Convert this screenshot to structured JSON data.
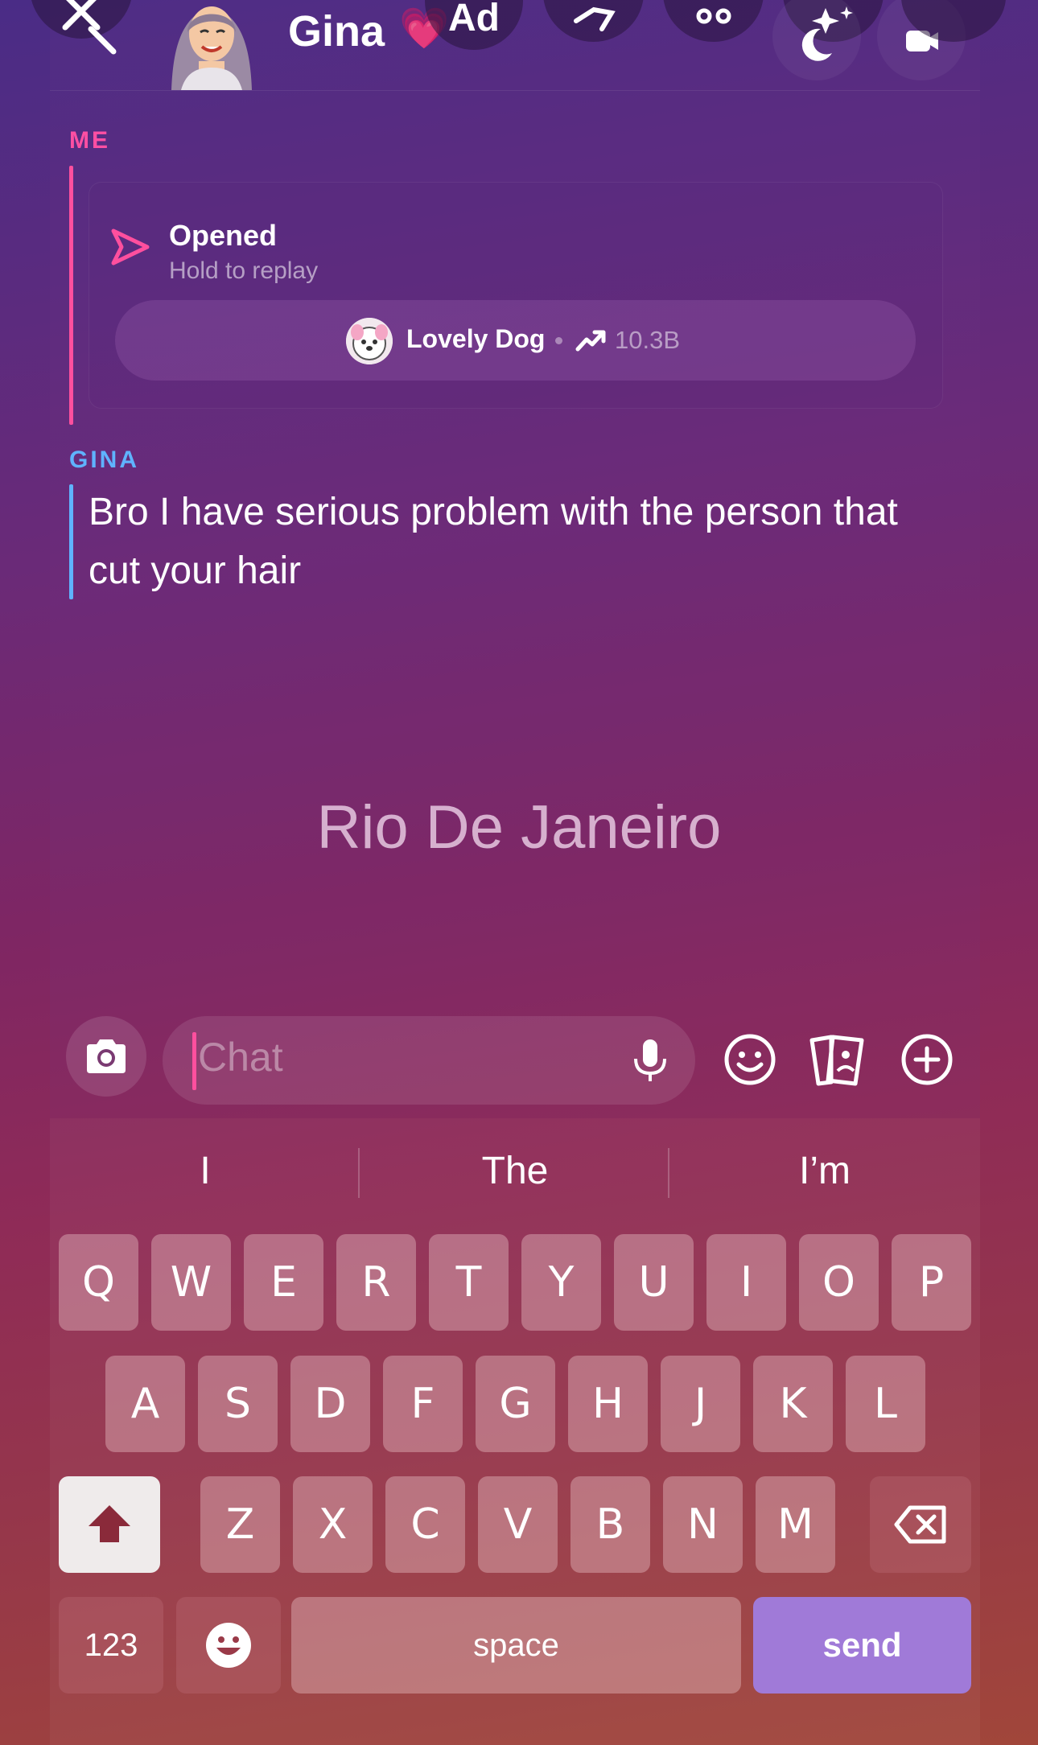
{
  "header": {
    "contact_name": "Gina",
    "heart_emoji": "💗",
    "partial_button_text": "Ad"
  },
  "messages": {
    "me": {
      "sender": "ME",
      "status_title": "Opened",
      "status_subtitle": "Hold to replay",
      "lens_name": "Lovely Dog",
      "lens_views": "10.3B"
    },
    "gina": {
      "sender": "GINA",
      "text": "Bro I have serious problem with the person that cut your hair"
    }
  },
  "location_label": "Rio De Janeiro",
  "chat": {
    "placeholder": "Chat"
  },
  "keyboard": {
    "suggestions": [
      "I",
      "The",
      "I’m"
    ],
    "row1": [
      "Q",
      "W",
      "E",
      "R",
      "T",
      "Y",
      "U",
      "I",
      "O",
      "P"
    ],
    "row2": [
      "A",
      "S",
      "D",
      "F",
      "G",
      "H",
      "J",
      "K",
      "L"
    ],
    "row3": [
      "Z",
      "X",
      "C",
      "V",
      "B",
      "N",
      "M"
    ],
    "numbers_label": "123",
    "space_label": "space",
    "send_label": "send"
  },
  "colors": {
    "me_accent": "#ff4f9e",
    "gina_accent": "#5fb3ff",
    "send_button": "#a07ad8"
  },
  "icons": {
    "header": [
      "close-icon",
      "search-icon",
      "edit-icon",
      "call-icon",
      "sparkle-icon",
      "moon-icon",
      "camera-icon"
    ],
    "chat_bar": [
      "camera-icon",
      "microphone-icon",
      "smile-icon",
      "cards-icon",
      "plus-circle-icon"
    ],
    "keyboard": [
      "shift-icon",
      "backspace-icon",
      "emoji-icon"
    ]
  }
}
